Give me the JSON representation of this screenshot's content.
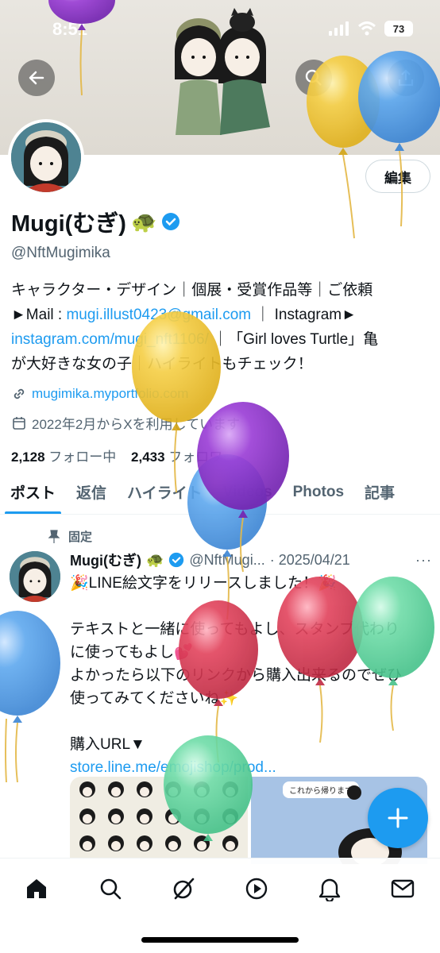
{
  "status_bar": {
    "time": "8:51",
    "battery": "73"
  },
  "header": {
    "edit_label": "編集"
  },
  "profile": {
    "name": "Mugi(むぎ)",
    "name_emoji": "🐢",
    "handle": "@NftMugimika",
    "bio": {
      "line1": "キャラクター・デザイン｜個展・受賞作品等｜ご依頼",
      "line2_prefix": "►Mail : ",
      "email": "mugi.illust0423@gmail.com",
      "line2_suffix": " ｜ Instagram►",
      "instagram_link": "instagram.com/mugi_nft1106/",
      "line3_suffix": " ｜「Girl loves Turtle」亀",
      "line4": "が大好きな女の子｜ハイライトもチェック！"
    },
    "website": "mugimika.myportfolio.com",
    "joined": "2022年2月からXを利用しています",
    "following_count": "2,128",
    "following_label": "フォロー中",
    "followers_count": "2,433",
    "followers_label": "フォロワー"
  },
  "tabs": [
    "ポスト",
    "返信",
    "ハイライト",
    "Videos",
    "Photos",
    "記事"
  ],
  "post": {
    "pinned_label": "固定",
    "name": "Mugi(むぎ)",
    "name_emoji": "🐢",
    "handle": "@NftMugi...",
    "date": "· 2025/04/21",
    "more": "···",
    "line1": "🎉LINE絵文字をリリースしました！🎉",
    "line2": "テキストと一緒に使ってもよし、スタンプ代わり",
    "line3": "に使ってもよし💕",
    "line4": "よかったら以下のリンクから購入出来るのでぜひ",
    "line5": "使ってみてくださいね✨",
    "line6": "購入URL▼",
    "link": "store.line.me/emojishop/prod...",
    "media_caption": "これから帰ります"
  },
  "colors": {
    "accent": "#1d9bf0",
    "balloon_yellow": "#f5cf48",
    "balloon_blue": "#5ea8ee",
    "balloon_purple": "#9b3fd6",
    "balloon_red": "#e2435c",
    "balloon_green": "#6fdca8"
  },
  "icons": {
    "back": "arrow-left-icon",
    "search": "search-icon",
    "share": "share-icon",
    "home": "home-icon",
    "explore": "search-icon",
    "grok": "grok-icon",
    "video": "play-icon",
    "notifications": "bell-icon",
    "messages": "mail-icon",
    "compose": "plus-icon"
  }
}
